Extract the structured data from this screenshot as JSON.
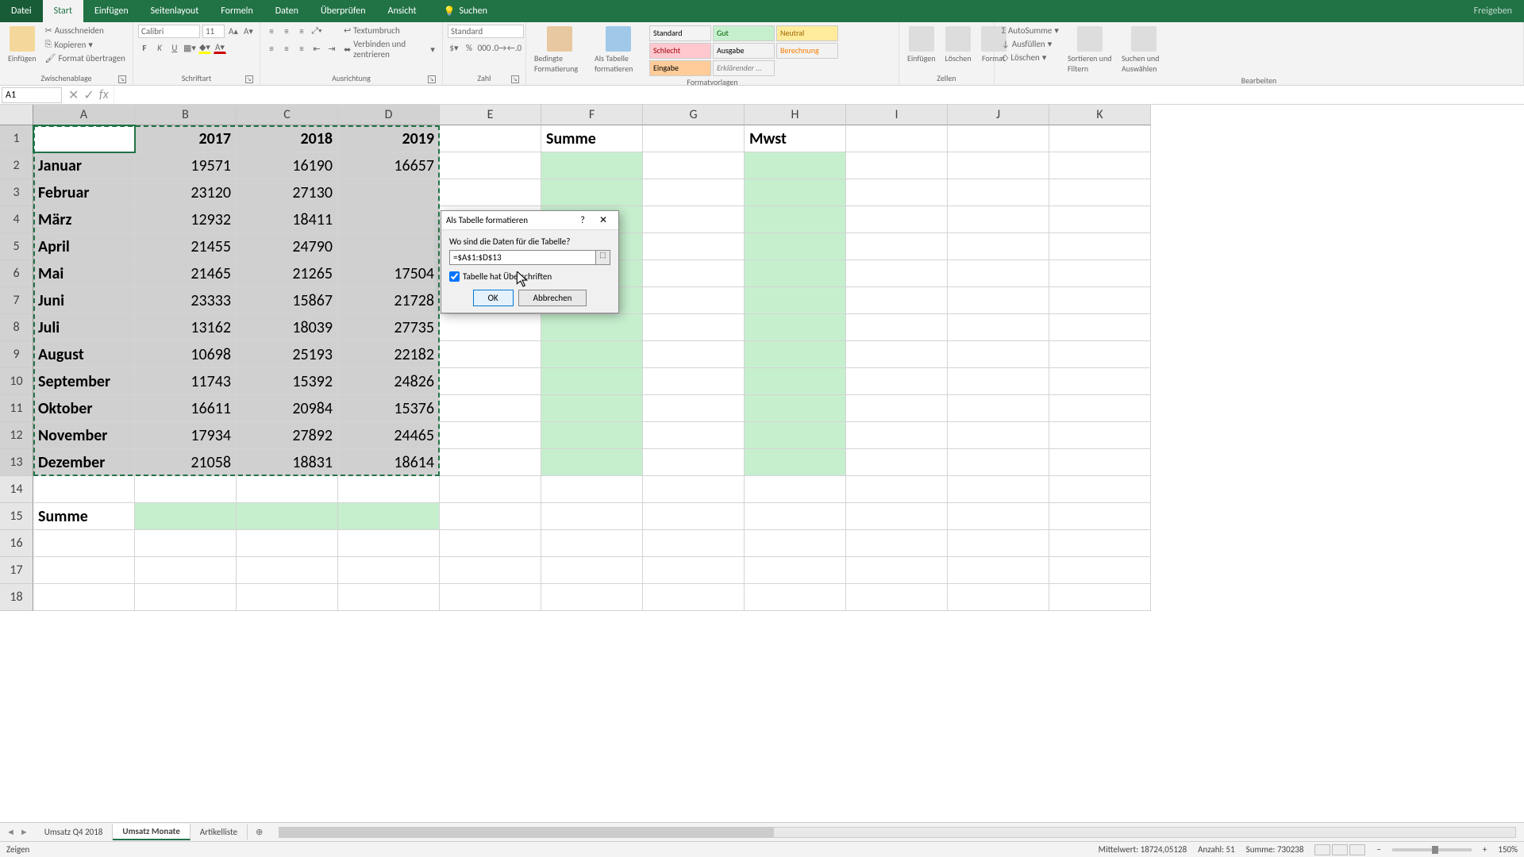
{
  "titlebar": {
    "file": "Datei",
    "tabs": [
      "Start",
      "Einfügen",
      "Seitenlayout",
      "Formeln",
      "Daten",
      "Überprüfen",
      "Ansicht"
    ],
    "active_tab": "Start",
    "search_label": "Suchen",
    "share": "Freigeben"
  },
  "ribbon": {
    "clipboard": {
      "label": "Zwischenablage",
      "paste": "Einfügen",
      "cut": "Ausschneiden",
      "copy": "Kopieren",
      "format_painter": "Format übertragen"
    },
    "font": {
      "label": "Schriftart",
      "name": "Calibri",
      "size": "11",
      "bold": "F",
      "italic": "K",
      "underline": "U"
    },
    "alignment": {
      "label": "Ausrichtung",
      "wrap": "Textumbruch",
      "merge": "Verbinden und zentrieren"
    },
    "number": {
      "label": "Zahl",
      "format": "Standard"
    },
    "styles": {
      "label": "Formatvorlagen",
      "conditional": "Bedingte Formatierung",
      "as_table": "Als Tabelle formatieren",
      "items": [
        "Standard",
        "Gut",
        "Neutral",
        "Schlecht",
        "Ausgabe",
        "Berechnung",
        "Eingabe",
        "Erklärender ..."
      ]
    },
    "cells": {
      "label": "Zellen",
      "insert": "Einfügen",
      "delete": "Löschen",
      "format": "Format"
    },
    "editing": {
      "label": "Bearbeiten",
      "autosum": "AutoSumme",
      "fill": "Ausfüllen",
      "clear": "Löschen",
      "sort": "Sortieren und Filtern",
      "find": "Suchen und Auswählen"
    }
  },
  "namebox": "A1",
  "columns": [
    "A",
    "B",
    "C",
    "D",
    "E",
    "F",
    "G",
    "H",
    "I",
    "J",
    "K"
  ],
  "rows_count": 18,
  "data": {
    "headers": [
      "",
      "2017",
      "2018",
      "2019"
    ],
    "months": [
      [
        "Januar",
        "19571",
        "16190",
        "16657"
      ],
      [
        "Februar",
        "23120",
        "27130",
        ""
      ],
      [
        "März",
        "12932",
        "18411",
        ""
      ],
      [
        "April",
        "21455",
        "24790",
        ""
      ],
      [
        "Mai",
        "21465",
        "21265",
        "17504"
      ],
      [
        "Juni",
        "23333",
        "15867",
        "21728"
      ],
      [
        "Juli",
        "13162",
        "18039",
        "27735"
      ],
      [
        "August",
        "10698",
        "25193",
        "22182"
      ],
      [
        "September",
        "11743",
        "15392",
        "24826"
      ],
      [
        "Oktober",
        "16611",
        "20984",
        "15376"
      ],
      [
        "November",
        "17934",
        "27892",
        "24465"
      ],
      [
        "Dezember",
        "21058",
        "18831",
        "18614"
      ]
    ],
    "summe_label": "Summe",
    "f1": "Summe",
    "h1": "Mwst"
  },
  "dialog": {
    "title": "Als Tabelle formatieren",
    "prompt": "Wo sind die Daten für die Tabelle?",
    "range": "=$A$1:$D$13",
    "checkbox": "Tabelle hat Überschriften",
    "checked": true,
    "ok": "OK",
    "cancel": "Abbrechen"
  },
  "sheets": {
    "tabs": [
      "Umsatz Q4 2018",
      "Umsatz Monate",
      "Artikelliste"
    ],
    "active": "Umsatz Monate"
  },
  "status": {
    "mode": "Zeigen",
    "avg_label": "Mittelwert:",
    "avg": "18724,05128",
    "count_label": "Anzahl:",
    "count": "51",
    "sum_label": "Summe:",
    "sum": "730238",
    "zoom": "150%"
  }
}
